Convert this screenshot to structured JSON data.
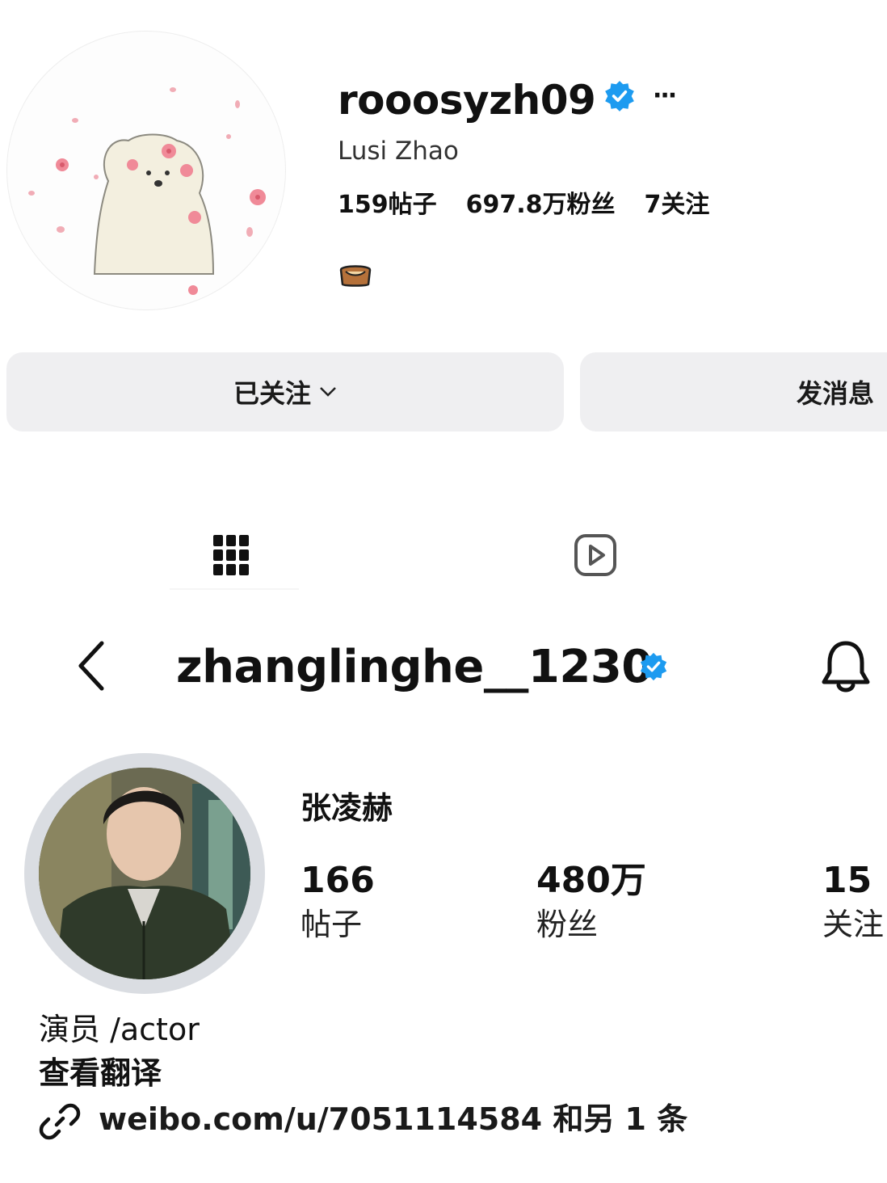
{
  "profile_top": {
    "username": "rooosyzh09",
    "full_name": "Lusi Zhao",
    "stats": {
      "posts": "159帖子",
      "followers": "697.8万粉丝",
      "following": "7关注"
    },
    "bio_emoji_icon": "bread-emoji-icon",
    "follow_button_label": "已关注",
    "message_button_label": "发消息",
    "more_label": "···",
    "tabs": [
      "grid-icon",
      "reels-icon"
    ]
  },
  "profile_main": {
    "username": "zhanglinghe__1230",
    "full_name": "张凌赫",
    "stats": {
      "posts_value": "166",
      "posts_label": "帖子",
      "followers_value": "480万",
      "followers_label": "粉丝",
      "following_value": "15",
      "following_label": "关注"
    },
    "bio": "演员 /actor",
    "see_translation": "查看翻译",
    "link_text": "weibo.com/u/7051114584 和另 1 条"
  },
  "colors": {
    "verified": "#1d9bf0",
    "button_bg": "#efeff1",
    "text": "#111111"
  }
}
